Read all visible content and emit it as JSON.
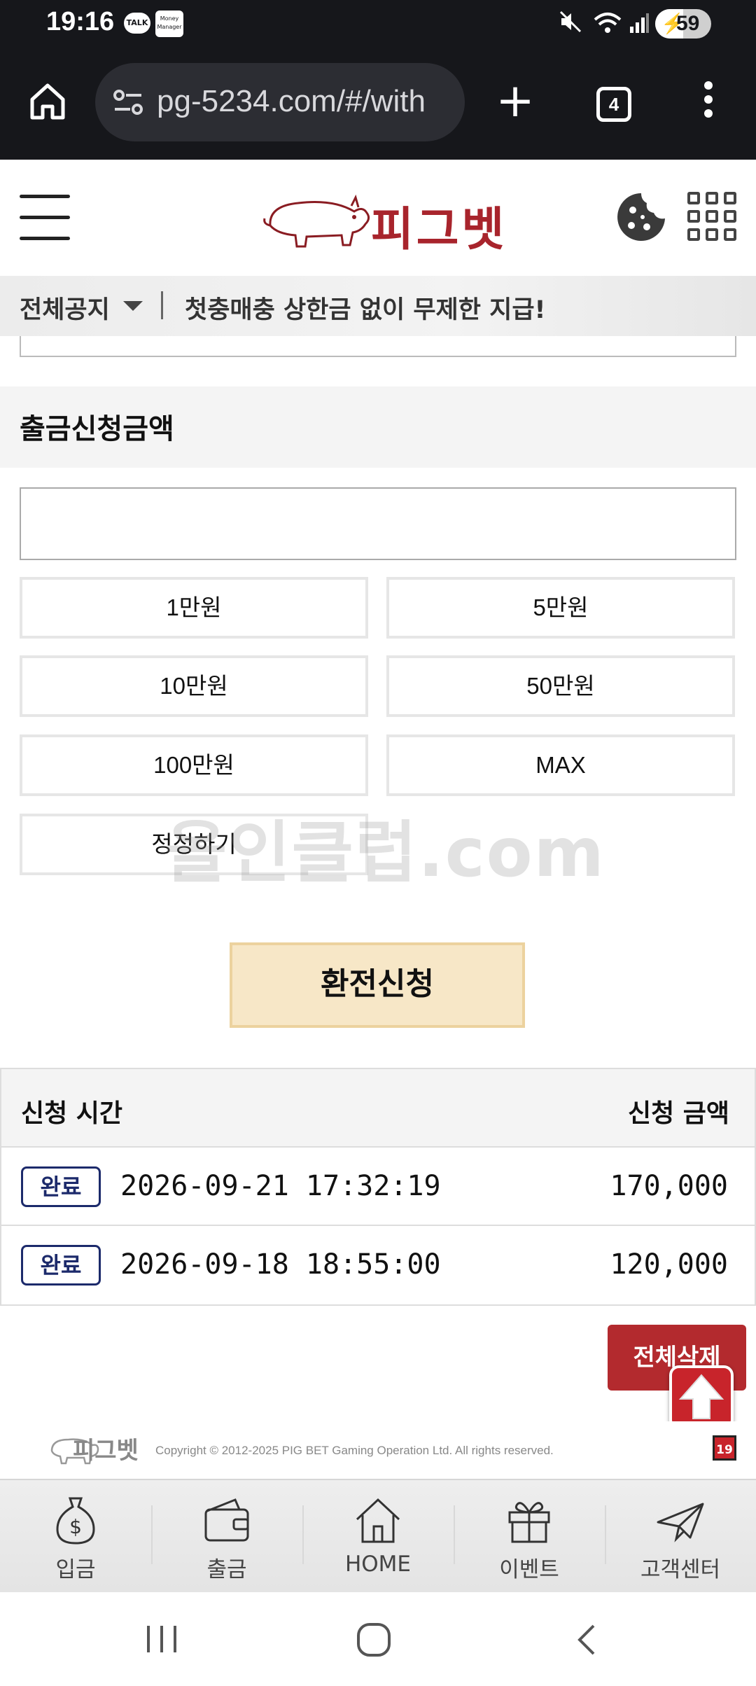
{
  "status_bar": {
    "time": "19:16",
    "talk_label": "TALK",
    "money_label": "Money Manager",
    "battery": "59"
  },
  "browser": {
    "url": "pg-5234.com/#/with",
    "tab_count": "4"
  },
  "header": {
    "logo_text": "피그벳"
  },
  "notice": {
    "label": "전체공지",
    "text": "첫충매충 상한금 없이 무제한 지급!"
  },
  "withdraw": {
    "section_title": "출금신청금액",
    "amount_value": "",
    "amount_buttons": [
      "1만원",
      "5만원",
      "10만원",
      "50만원",
      "100만원",
      "MAX",
      "정정하기"
    ],
    "submit_label": "환전신청"
  },
  "watermark": "올인클럽.com",
  "history": {
    "col_time": "신청 시간",
    "col_amount": "신청 금액",
    "rows": [
      {
        "status": "완료",
        "datetime": "2026-09-21 17:32:19",
        "amount": "170,000"
      },
      {
        "status": "완료",
        "datetime": "2026-09-18 18:55:00",
        "amount": "120,000"
      }
    ],
    "delete_all_label": "전체삭제"
  },
  "footer": {
    "logo_text": "피그벳",
    "copyright": "Copyright © 2012-2025 PIG BET Gaming Operation Ltd. All rights reserved.",
    "age_badge": "19"
  },
  "bottom_nav": [
    {
      "label": "입금",
      "icon": "money-bag-icon"
    },
    {
      "label": "출금",
      "icon": "wallet-icon"
    },
    {
      "label": "HOME",
      "icon": "home-icon"
    },
    {
      "label": "이벤트",
      "icon": "gift-icon"
    },
    {
      "label": "고객센터",
      "icon": "paper-plane-icon"
    }
  ],
  "colors": {
    "brand_red": "#a8242c",
    "badge_navy": "#1c2a6b",
    "submit_bg": "#f7e7c7",
    "delete_red": "#b32a2e"
  }
}
